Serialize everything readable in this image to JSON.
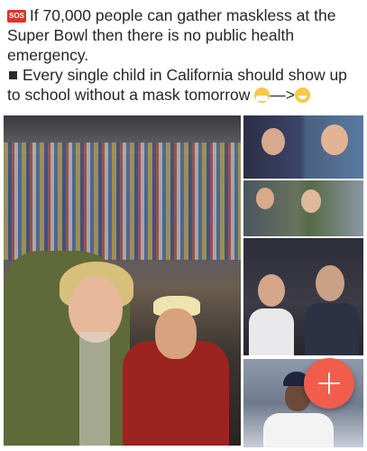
{
  "post": {
    "badge_label": "SOS",
    "line1": "If 70,000 people can gather maskless at the",
    "line2": "Super Bowl then there is no public health",
    "line3": "emergency.",
    "line4": "Every single child in California should show up",
    "line5": "to school without a mask tomorrow",
    "arrow": "—>"
  },
  "icons": {
    "badge": "sos-emoji-icon",
    "bullet": "black-square-bullet-icon",
    "emoji1": "face-with-medical-mask-icon",
    "emoji2": "grinning-face-icon",
    "fab": "plus-icon"
  },
  "colors": {
    "badge_red": "#e0322b",
    "fab_coral": "#f05d4d",
    "text": "#262626"
  }
}
